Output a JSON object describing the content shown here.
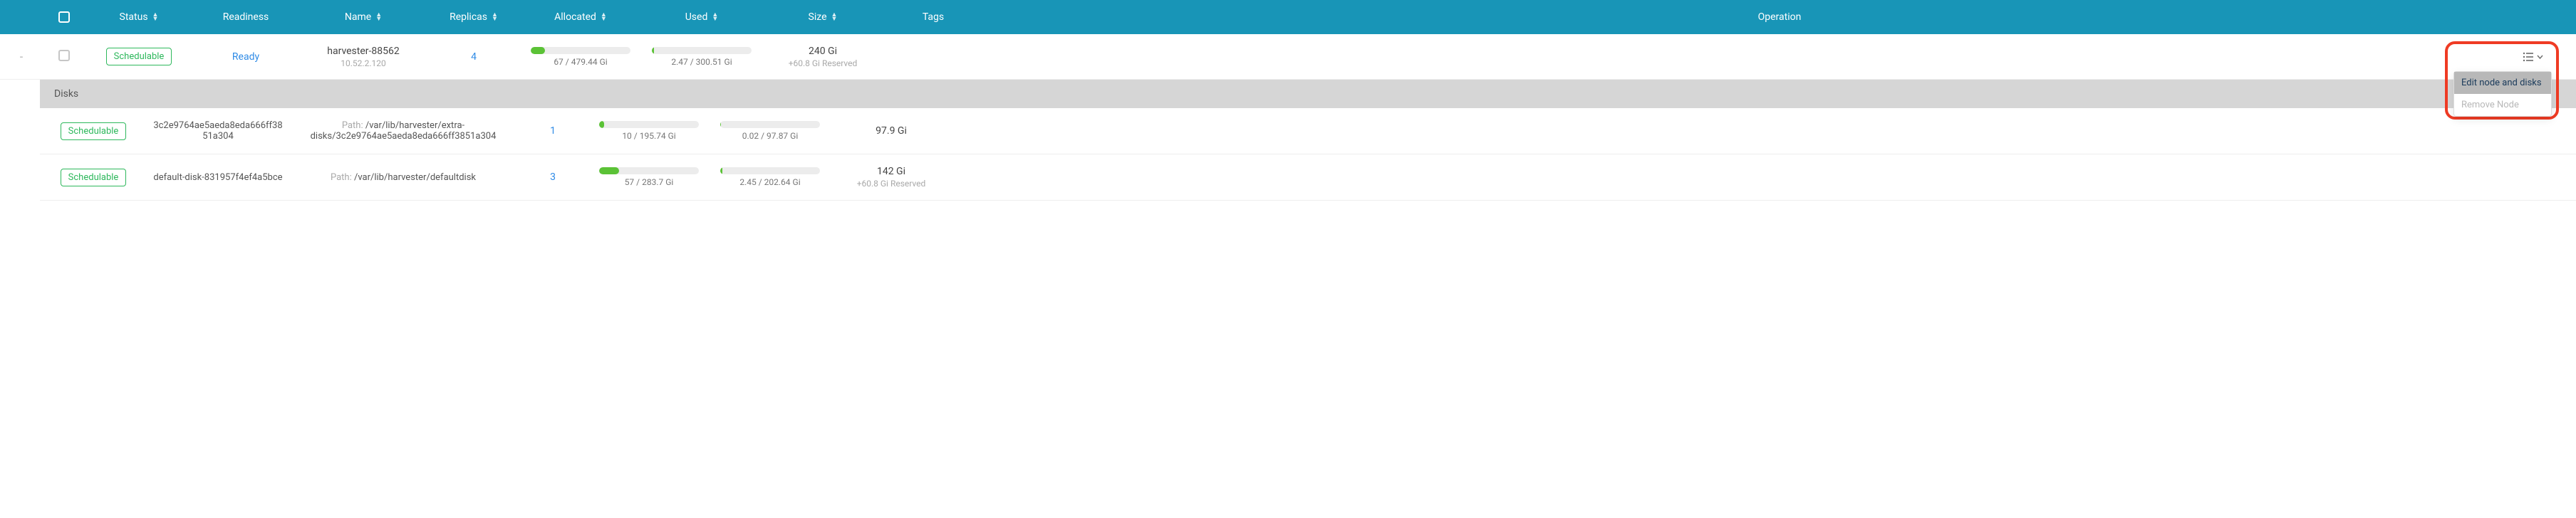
{
  "columns": {
    "status": "Status",
    "readiness": "Readiness",
    "name": "Name",
    "replicas": "Replicas",
    "allocated": "Allocated",
    "used": "Used",
    "size": "Size",
    "tags": "Tags",
    "operation": "Operation"
  },
  "node": {
    "status": "Schedulable",
    "readiness": "Ready",
    "name": "harvester-88562",
    "ip": "10.52.2.120",
    "replicas": "4",
    "allocated": {
      "pct": 14,
      "text": "67 / 479.44 Gi"
    },
    "used": {
      "pct": 1,
      "text": "2.47 / 300.51 Gi"
    },
    "size": "240 Gi",
    "reserved": "+60.8 Gi Reserved"
  },
  "menu": {
    "edit": "Edit node and disks",
    "remove": "Remove Node"
  },
  "disks_label": "Disks",
  "path_label": "Path:",
  "disks": [
    {
      "status": "Schedulable",
      "name": "3c2e9764ae5aeda8eda666ff3851a304",
      "path": "/var/lib/harvester/extra-disks/3c2e9764ae5aeda8eda666ff3851a304",
      "replicas": "1",
      "allocated": {
        "pct": 5,
        "text": "10 / 195.74 Gi"
      },
      "used": {
        "pct": 0,
        "text": "0.02 / 97.87 Gi"
      },
      "size": "97.9 Gi",
      "reserved": ""
    },
    {
      "status": "Schedulable",
      "name": "default-disk-831957f4ef4a5bce",
      "path": "/var/lib/harvester/defaultdisk",
      "replicas": "3",
      "allocated": {
        "pct": 20,
        "text": "57 / 283.7 Gi"
      },
      "used": {
        "pct": 2,
        "text": "2.45 / 202.64 Gi"
      },
      "size": "142 Gi",
      "reserved": "+60.8 Gi Reserved"
    }
  ]
}
